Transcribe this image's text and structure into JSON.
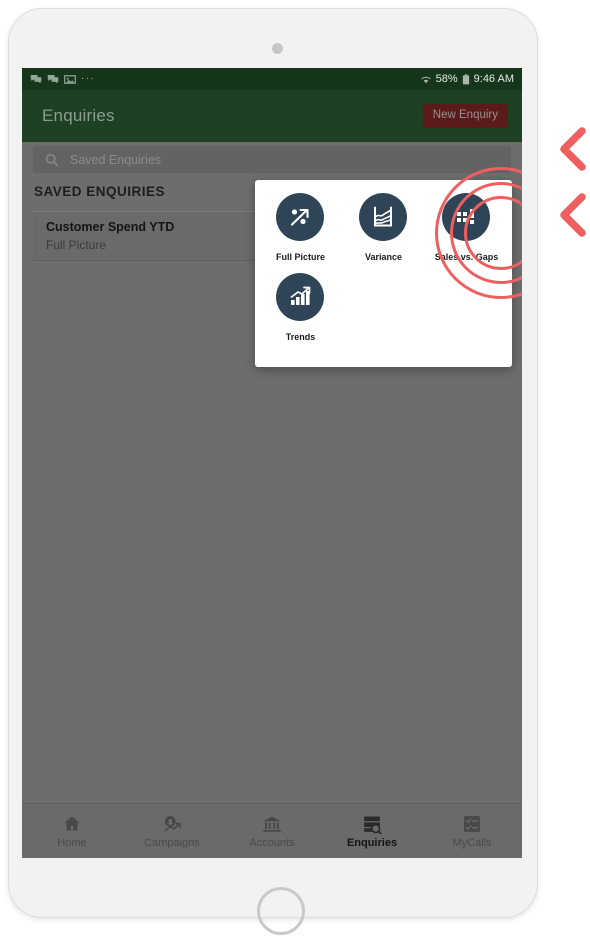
{
  "device": {
    "camera": "front-camera",
    "home_button": "home-button"
  },
  "status_bar": {
    "icons": [
      "chat-icon",
      "chat-icon",
      "image-icon"
    ],
    "overflow": "···",
    "wifi": "wifi-icon",
    "battery_percent": "58%",
    "battery": "battery-icon",
    "time": "9:46 AM"
  },
  "app_bar": {
    "title": "Enquiries",
    "new_enquiry_label": "New Enquiry"
  },
  "search": {
    "placeholder": "Saved Enquiries",
    "value": ""
  },
  "saved": {
    "section_title": "SAVED ENQUIRIES",
    "items": [
      {
        "title": "Customer Spend YTD",
        "subtitle": "Full Picture"
      }
    ]
  },
  "new_enquiry_menu": {
    "items": [
      {
        "label": "Full Picture",
        "icon": "percent-trend-icon"
      },
      {
        "label": "Variance",
        "icon": "line-chart-icon"
      },
      {
        "label": "Sales vs. Gaps",
        "icon": "bar-grid-icon"
      },
      {
        "label": "Trends",
        "icon": "bar-chart-arrow-icon"
      }
    ]
  },
  "bottom_nav": {
    "items": [
      {
        "label": "Home",
        "icon": "home-icon",
        "active": false
      },
      {
        "label": "Campaigns",
        "icon": "campaigns-icon",
        "active": false
      },
      {
        "label": "Accounts",
        "icon": "bank-icon",
        "active": false
      },
      {
        "label": "Enquiries",
        "icon": "enquiries-icon",
        "active": true
      },
      {
        "label": "MyCalls",
        "icon": "checklist-icon",
        "active": false
      }
    ]
  },
  "annotations": {
    "highlight_target": "New Enquiry",
    "ring_color": "#ef5f5f",
    "chevrons": 2
  },
  "colors": {
    "header_green": "#1e4023",
    "status_green": "#16361c",
    "button_red": "#5c1b1b",
    "icon_navy": "#2f4456",
    "dim_overlay": "#6d6d6d",
    "accent_red": "#ef5f5f"
  }
}
